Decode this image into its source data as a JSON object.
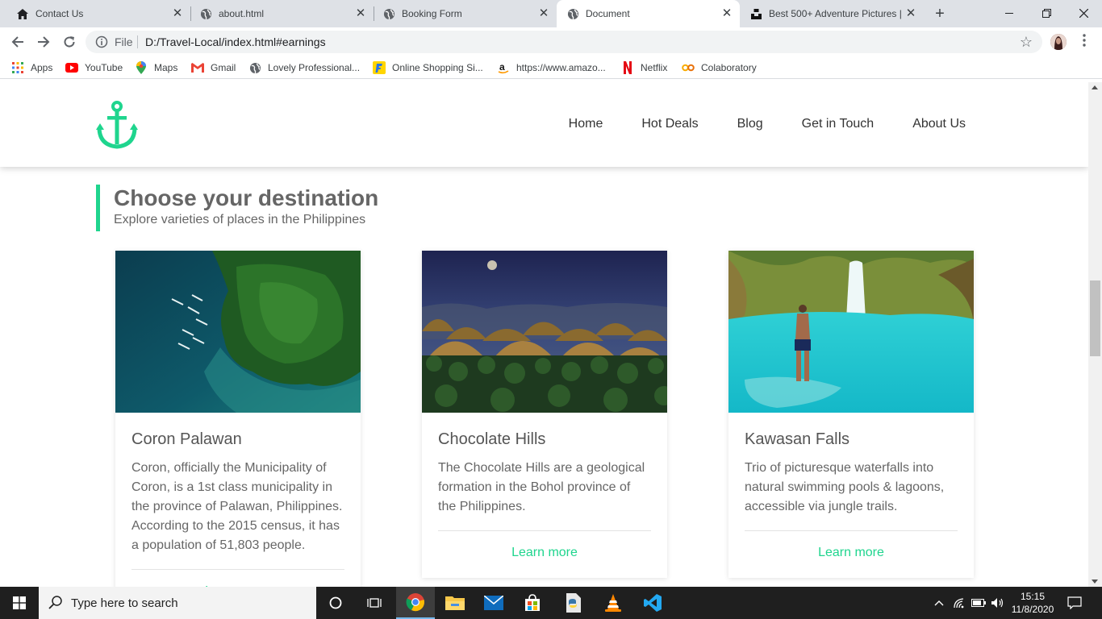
{
  "browser": {
    "tabs": [
      {
        "label": "Contact Us",
        "icon": "home-icon",
        "active": false
      },
      {
        "label": "about.html",
        "icon": "globe-icon",
        "active": false
      },
      {
        "label": "Booking Form",
        "icon": "globe-icon",
        "active": false
      },
      {
        "label": "Document",
        "icon": "globe-icon",
        "active": true
      },
      {
        "label": "Best 500+ Adventure Pictures |",
        "icon": "unsplash-icon",
        "active": false
      }
    ],
    "omnibox": {
      "scheme_label": "File",
      "url": "D:/Travel-Local/index.html#earnings"
    },
    "bookmarks": [
      {
        "label": "Apps",
        "icon": "apps-grid-icon"
      },
      {
        "label": "YouTube",
        "icon": "youtube-icon"
      },
      {
        "label": "Maps",
        "icon": "maps-pin-icon"
      },
      {
        "label": "Gmail",
        "icon": "gmail-icon"
      },
      {
        "label": "Lovely Professional...",
        "icon": "globe-icon"
      },
      {
        "label": "Online Shopping Si...",
        "icon": "flipkart-icon"
      },
      {
        "label": "https://www.amazo...",
        "icon": "amazon-icon"
      },
      {
        "label": "Netflix",
        "icon": "netflix-icon"
      },
      {
        "label": "Colaboratory",
        "icon": "colab-icon"
      }
    ]
  },
  "site": {
    "accent": "#1fd58e",
    "nav": [
      "Home",
      "Hot Deals",
      "Blog",
      "Get in Touch",
      "About Us"
    ],
    "section": {
      "title": "Choose your destination",
      "subtitle": "Explore varieties of places in the Philippines"
    },
    "cards": [
      {
        "title": "Coron Palawan",
        "text": "Coron, officially the Municipality of Coron, is a 1st class municipality in the province of Palawan, Philippines. According to the 2015 census, it has a population of 51,803 people.",
        "link": "Learn more"
      },
      {
        "title": "Chocolate Hills",
        "text": "The Chocolate Hills are a geological formation in the Bohol province of the Philippines.",
        "link": "Learn more"
      },
      {
        "title": "Kawasan Falls",
        "text": "Trio of picturesque waterfalls into natural swimming pools & lagoons, accessible via jungle trails.",
        "link": "Learn more"
      }
    ]
  },
  "taskbar": {
    "search_placeholder": "Type here to search",
    "time": "15:15",
    "date": "11/8/2020"
  }
}
